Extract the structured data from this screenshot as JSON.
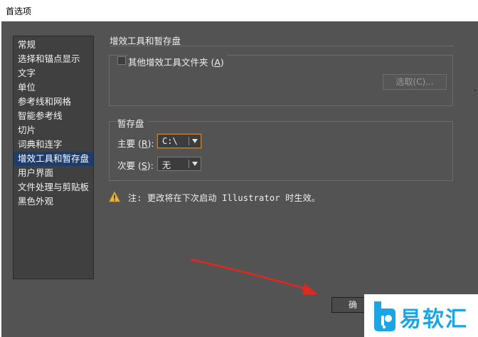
{
  "window": {
    "title": "首选项"
  },
  "sidebar": {
    "items": [
      {
        "label": "常规"
      },
      {
        "label": "选择和锚点显示"
      },
      {
        "label": "文字"
      },
      {
        "label": "单位"
      },
      {
        "label": "参考线和网格"
      },
      {
        "label": "智能参考线"
      },
      {
        "label": "切片"
      },
      {
        "label": "词典和连字"
      },
      {
        "label": "增效工具和暂存盘"
      },
      {
        "label": "用户界面"
      },
      {
        "label": "文件处理与剪贴板"
      },
      {
        "label": "黑色外观"
      }
    ],
    "selected_index": 8
  },
  "main": {
    "section_title": "增效工具和暂存盘",
    "plugins": {
      "checkbox_label_prefix": "其他增效工具文件夹 (",
      "checkbox_label_key": "A",
      "checkbox_label_suffix": ")",
      "checked": false,
      "choose_button_label": "选取(C)..."
    },
    "scratch": {
      "title": "暂存盘",
      "primary_label_prefix": "主要 (",
      "primary_label_key": "R",
      "primary_label_suffix": "):",
      "primary_value": "C:\\",
      "secondary_label_prefix": "次要 (",
      "secondary_label_key": "S",
      "secondary_label_suffix": "):",
      "secondary_value": "无"
    },
    "note": "注: 更改将在下次启动 Illustrator 时生效。"
  },
  "footer": {
    "ok_label": "确"
  },
  "watermark": {
    "text": "易软汇"
  },
  "colors": {
    "background": "#535353",
    "selected_item": "#1e3d6a",
    "warning": "#e8b43a",
    "annotation_arrow": "#e0281e",
    "watermark_text": "#1aa6e6"
  }
}
